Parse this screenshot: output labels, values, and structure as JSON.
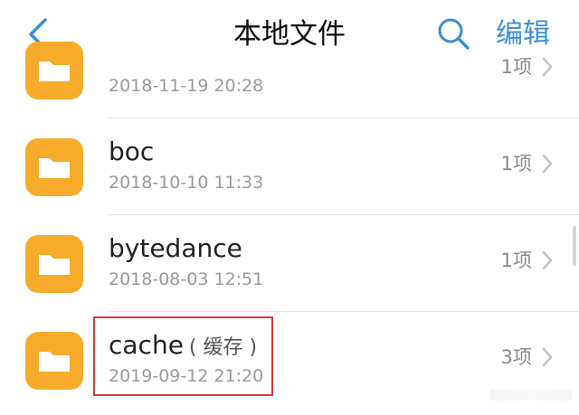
{
  "header": {
    "title": "本地文件",
    "edit_label": "编辑"
  },
  "colors": {
    "accent": "#3a8fd6",
    "folder": "#f6ab2a",
    "highlight": "#d73b3b"
  },
  "files": [
    {
      "name": "",
      "date": "2018-11-19 20:28",
      "count": "1项"
    },
    {
      "name": "boc",
      "date": "2018-10-10 11:33",
      "count": "1项"
    },
    {
      "name": "bytedance",
      "date": "2018-08-03 12:51",
      "count": "1项"
    },
    {
      "name": "cache",
      "tag": "( 缓存 )",
      "date": "2019-09-12 21:20",
      "count": "3项"
    }
  ]
}
